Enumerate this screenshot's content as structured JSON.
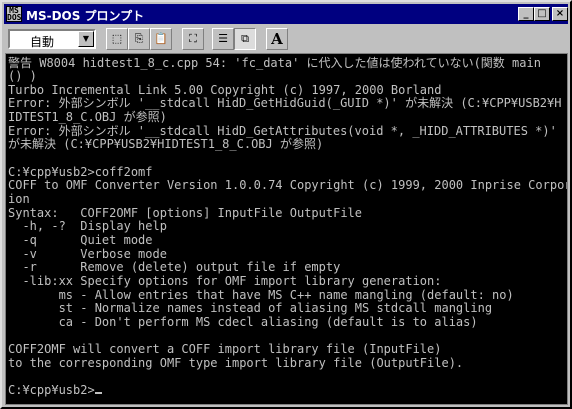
{
  "window": {
    "title": "MS-DOS プロンプト",
    "icon_text": "MS\nDOS",
    "buttons": {
      "minimize": "_",
      "maximize": "□",
      "close": "×"
    }
  },
  "toolbar": {
    "font_value": "自動",
    "font_arrow": "▼",
    "tools": [
      {
        "name": "mark-tool-icon",
        "glyph": "⬚"
      },
      {
        "name": "copy-tool-icon",
        "glyph": "⎘"
      },
      {
        "name": "paste-tool-icon",
        "glyph": "📋"
      },
      {
        "name": "fullscreen-tool-icon",
        "glyph": "⛶"
      },
      {
        "name": "properties-tool-icon",
        "glyph": "☰"
      },
      {
        "name": "background-tool-icon",
        "glyph": "⧉"
      },
      {
        "name": "font-tool-icon",
        "glyph": "A"
      }
    ]
  },
  "console": {
    "lines": [
      "警告 W8004 hidtest1_8_c.cpp 54: 'fc_data' に代入した値は使われていない(関数 main",
      "() )",
      "Turbo Incremental Link 5.00 Copyright (c) 1997, 2000 Borland",
      "Error: 外部シンボル '__stdcall HidD_GetHidGuid(_GUID *)' が未解決 (C:¥CPP¥USB2¥H",
      "IDTEST1_8_C.OBJ が参照)",
      "Error: 外部シンボル '__stdcall HidD_GetAttributes(void *, _HIDD_ATTRIBUTES *)'",
      "が未解決 (C:¥CPP¥USB2¥HIDTEST1_8_C.OBJ が参照)",
      "",
      "C:¥cpp¥usb2>coff2omf",
      "COFF to OMF Converter Version 1.0.0.74 Copyright (c) 1999, 2000 Inprise Corporat",
      "ion",
      "Syntax:   COFF2OMF [options] InputFile OutputFile",
      "  -h, -?  Display help",
      "  -q      Quiet mode",
      "  -v      Verbose mode",
      "  -r      Remove (delete) output file if empty",
      "  -lib:xx Specify options for OMF import library generation:",
      "       ms - Allow entries that have MS C++ name mangling (default: no)",
      "       st - Normalize names instead of aliasing MS stdcall mangling",
      "       ca - Don't perform MS cdecl aliasing (default is to alias)",
      "",
      "COFF2OMF will convert a COFF import library file (InputFile)",
      "to the corresponding OMF type import library file (OutputFile).",
      "",
      "C:¥cpp¥usb2>"
    ]
  }
}
